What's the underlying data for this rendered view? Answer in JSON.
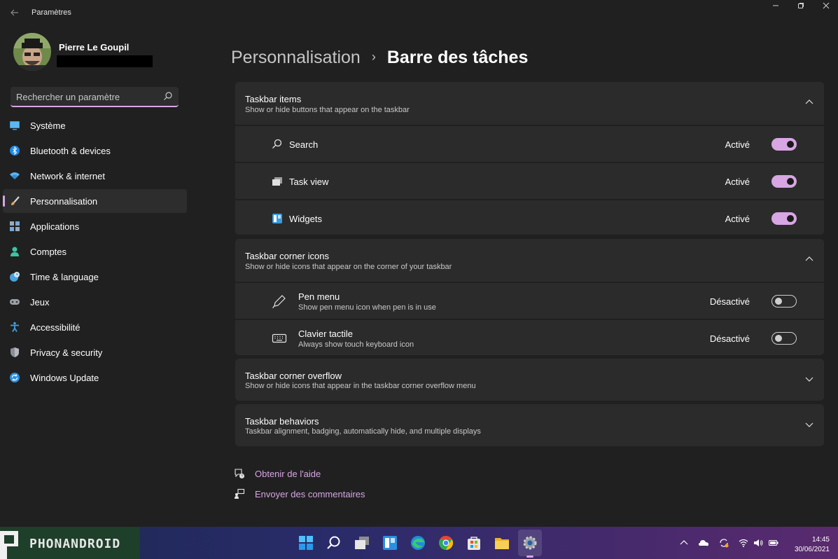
{
  "window": {
    "app_title": "Paramètres",
    "back_icon": "back-arrow-icon"
  },
  "profile": {
    "name": "Pierre Le Goupil"
  },
  "search": {
    "placeholder": "Rechercher un paramètre"
  },
  "sidebar": {
    "items": [
      {
        "label": "Système",
        "icon": "monitor-icon",
        "color": "#3a9bdc"
      },
      {
        "label": "Bluetooth & devices",
        "icon": "bluetooth-icon",
        "color": "#1e88e5"
      },
      {
        "label": "Network & internet",
        "icon": "wifi-icon",
        "color": "#5ab4f5"
      },
      {
        "label": "Personnalisation",
        "icon": "brush-icon",
        "color": "#e0a060",
        "active": true
      },
      {
        "label": "Applications",
        "icon": "apps-icon",
        "color": "#7aa7d8"
      },
      {
        "label": "Comptes",
        "icon": "person-icon",
        "color": "#3cc4a4"
      },
      {
        "label": "Time & language",
        "icon": "globe-clock-icon",
        "color": "#4aa3df"
      },
      {
        "label": "Jeux",
        "icon": "gamepad-icon",
        "color": "#9aa0a6"
      },
      {
        "label": "Accessibilité",
        "icon": "accessibility-icon",
        "color": "#3aa0e8"
      },
      {
        "label": "Privacy & security",
        "icon": "shield-icon",
        "color": "#8a8f96"
      },
      {
        "label": "Windows Update",
        "icon": "update-icon",
        "color": "#2a8fe0"
      }
    ]
  },
  "header": {
    "parent": "Personnalisation",
    "separator": "›",
    "current": "Barre des tâches"
  },
  "cards": {
    "items": {
      "title": "Taskbar items",
      "subtitle": "Show or hide buttons that appear on the taskbar",
      "expanded": true,
      "rows": [
        {
          "label": "Search",
          "state": "Activé",
          "on": true,
          "icon": "search-icon"
        },
        {
          "label": "Task view",
          "state": "Activé",
          "on": true,
          "icon": "task-view-icon"
        },
        {
          "label": "Widgets",
          "state": "Activé",
          "on": true,
          "icon": "widgets-icon"
        }
      ]
    },
    "corner": {
      "title": "Taskbar corner icons",
      "subtitle": "Show or hide icons that appear on the corner of your taskbar",
      "expanded": true,
      "rows": [
        {
          "label": "Pen menu",
          "sub": "Show pen menu icon when pen is in use",
          "state": "Désactivé",
          "on": false,
          "icon": "pen-icon"
        },
        {
          "label": "Clavier tactile",
          "sub": "Always show touch keyboard icon",
          "state": "Désactivé",
          "on": false,
          "icon": "keyboard-icon"
        }
      ]
    },
    "overflow": {
      "title": "Taskbar corner overflow",
      "subtitle": "Show or hide icons that appear in the taskbar corner overflow menu",
      "expanded": false
    },
    "behaviors": {
      "title": "Taskbar behaviors",
      "subtitle": "Taskbar alignment, badging, automatically hide, and multiple displays",
      "expanded": false
    }
  },
  "links": {
    "help": "Obtenir de l'aide",
    "feedback": "Envoyer des commentaires"
  },
  "taskbar": {
    "brand": "PHONANDROID",
    "apps": [
      "start-icon",
      "search-icon",
      "task-view-icon",
      "widgets-icon",
      "edge-icon",
      "chrome-icon",
      "store-icon",
      "file-explorer-icon",
      "settings-icon"
    ],
    "active_app": "settings-icon",
    "tray": [
      "chevron-up-icon",
      "onedrive-icon",
      "sync-icon",
      "wifi-icon",
      "volume-icon",
      "battery-icon"
    ],
    "time": "14:45",
    "date": "30/06/2021"
  },
  "colors": {
    "accent": "#d7a6e3",
    "background": "#202020",
    "card": "#2b2b2b"
  }
}
